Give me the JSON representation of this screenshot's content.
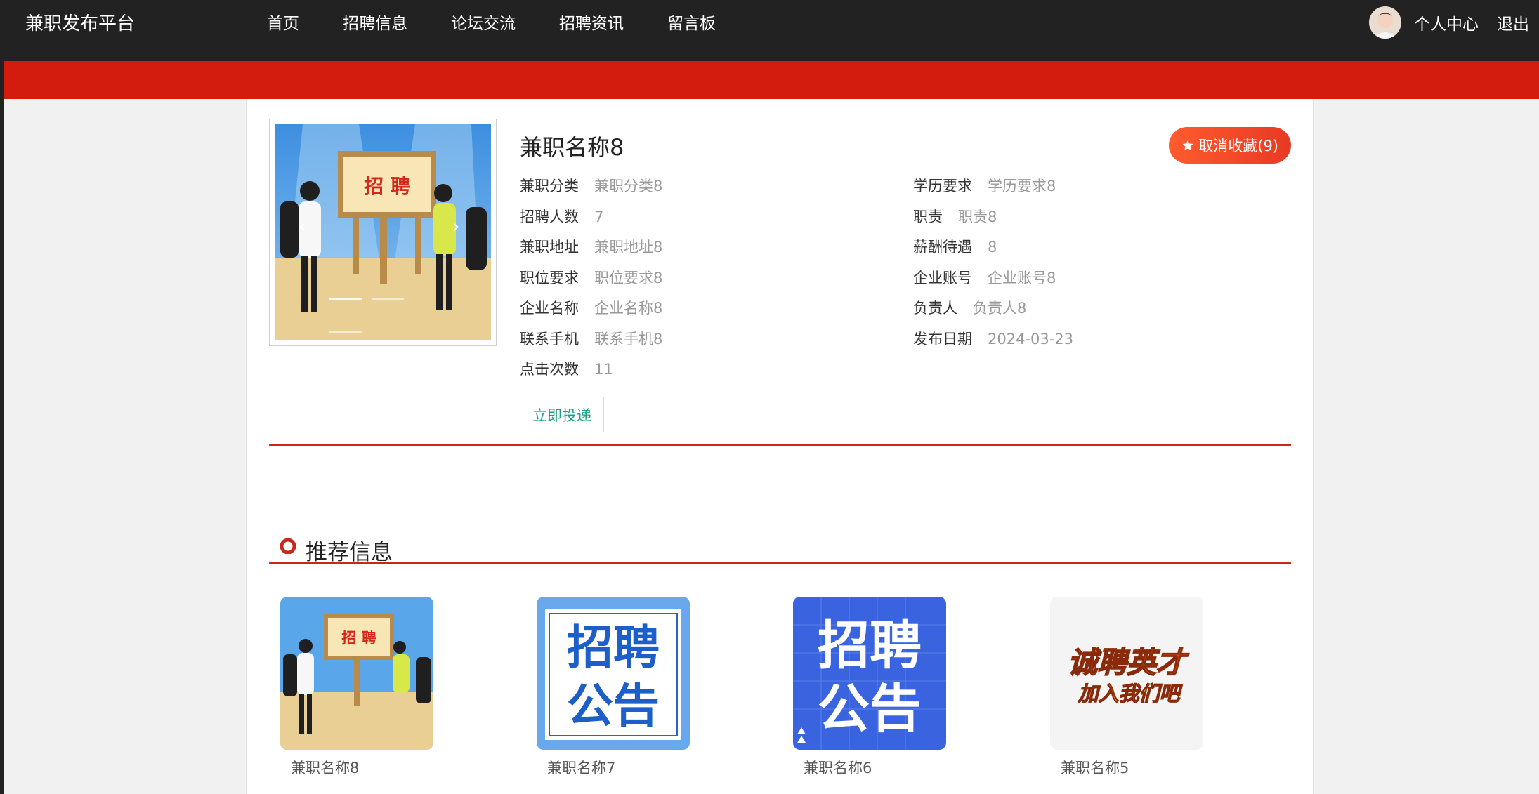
{
  "header": {
    "brand": "兼职发布平台",
    "nav": [
      "首页",
      "招聘信息",
      "论坛交流",
      "招聘资讯",
      "留言板"
    ],
    "user_center": "个人中心",
    "logout": "退出"
  },
  "detail": {
    "title": "兼职名称8",
    "favorite_label": "取消收藏(9)",
    "apply_label": "立即投递",
    "left_fields": [
      {
        "key": "兼职分类",
        "value": "兼职分类8"
      },
      {
        "key": "招聘人数",
        "value": "7"
      },
      {
        "key": "兼职地址",
        "value": "兼职地址8"
      },
      {
        "key": "职位要求",
        "value": "职位要求8"
      },
      {
        "key": "企业名称",
        "value": "企业名称8"
      },
      {
        "key": "联系手机",
        "value": "联系手机8"
      },
      {
        "key": "点击次数",
        "value": "11"
      }
    ],
    "right_fields": [
      {
        "key": "学历要求",
        "value": "学历要求8"
      },
      {
        "key": "职责",
        "value": "职责8"
      },
      {
        "key": "薪酬待遇",
        "value": "8"
      },
      {
        "key": "企业账号",
        "value": "企业账号8"
      },
      {
        "key": "负责人",
        "value": "负责人8"
      },
      {
        "key": "发布日期",
        "value": "2024-03-23"
      }
    ],
    "carousel_text": "招 聘"
  },
  "recommend": {
    "title": "推荐信息",
    "items": [
      {
        "name": "兼职名称8",
        "image_text": "招 聘"
      },
      {
        "name": "兼职名称7",
        "image_text": [
          "招聘",
          "公告"
        ]
      },
      {
        "name": "兼职名称6",
        "image_text": [
          "招聘",
          "公告"
        ]
      },
      {
        "name": "兼职名称5",
        "image_text": [
          "诚聘英才",
          "加入我们吧"
        ]
      }
    ]
  },
  "colors": {
    "topbar": "#222222",
    "red_band": "#d31b0e",
    "accent_red": "#c8281c",
    "apply_green": "#17a085"
  }
}
